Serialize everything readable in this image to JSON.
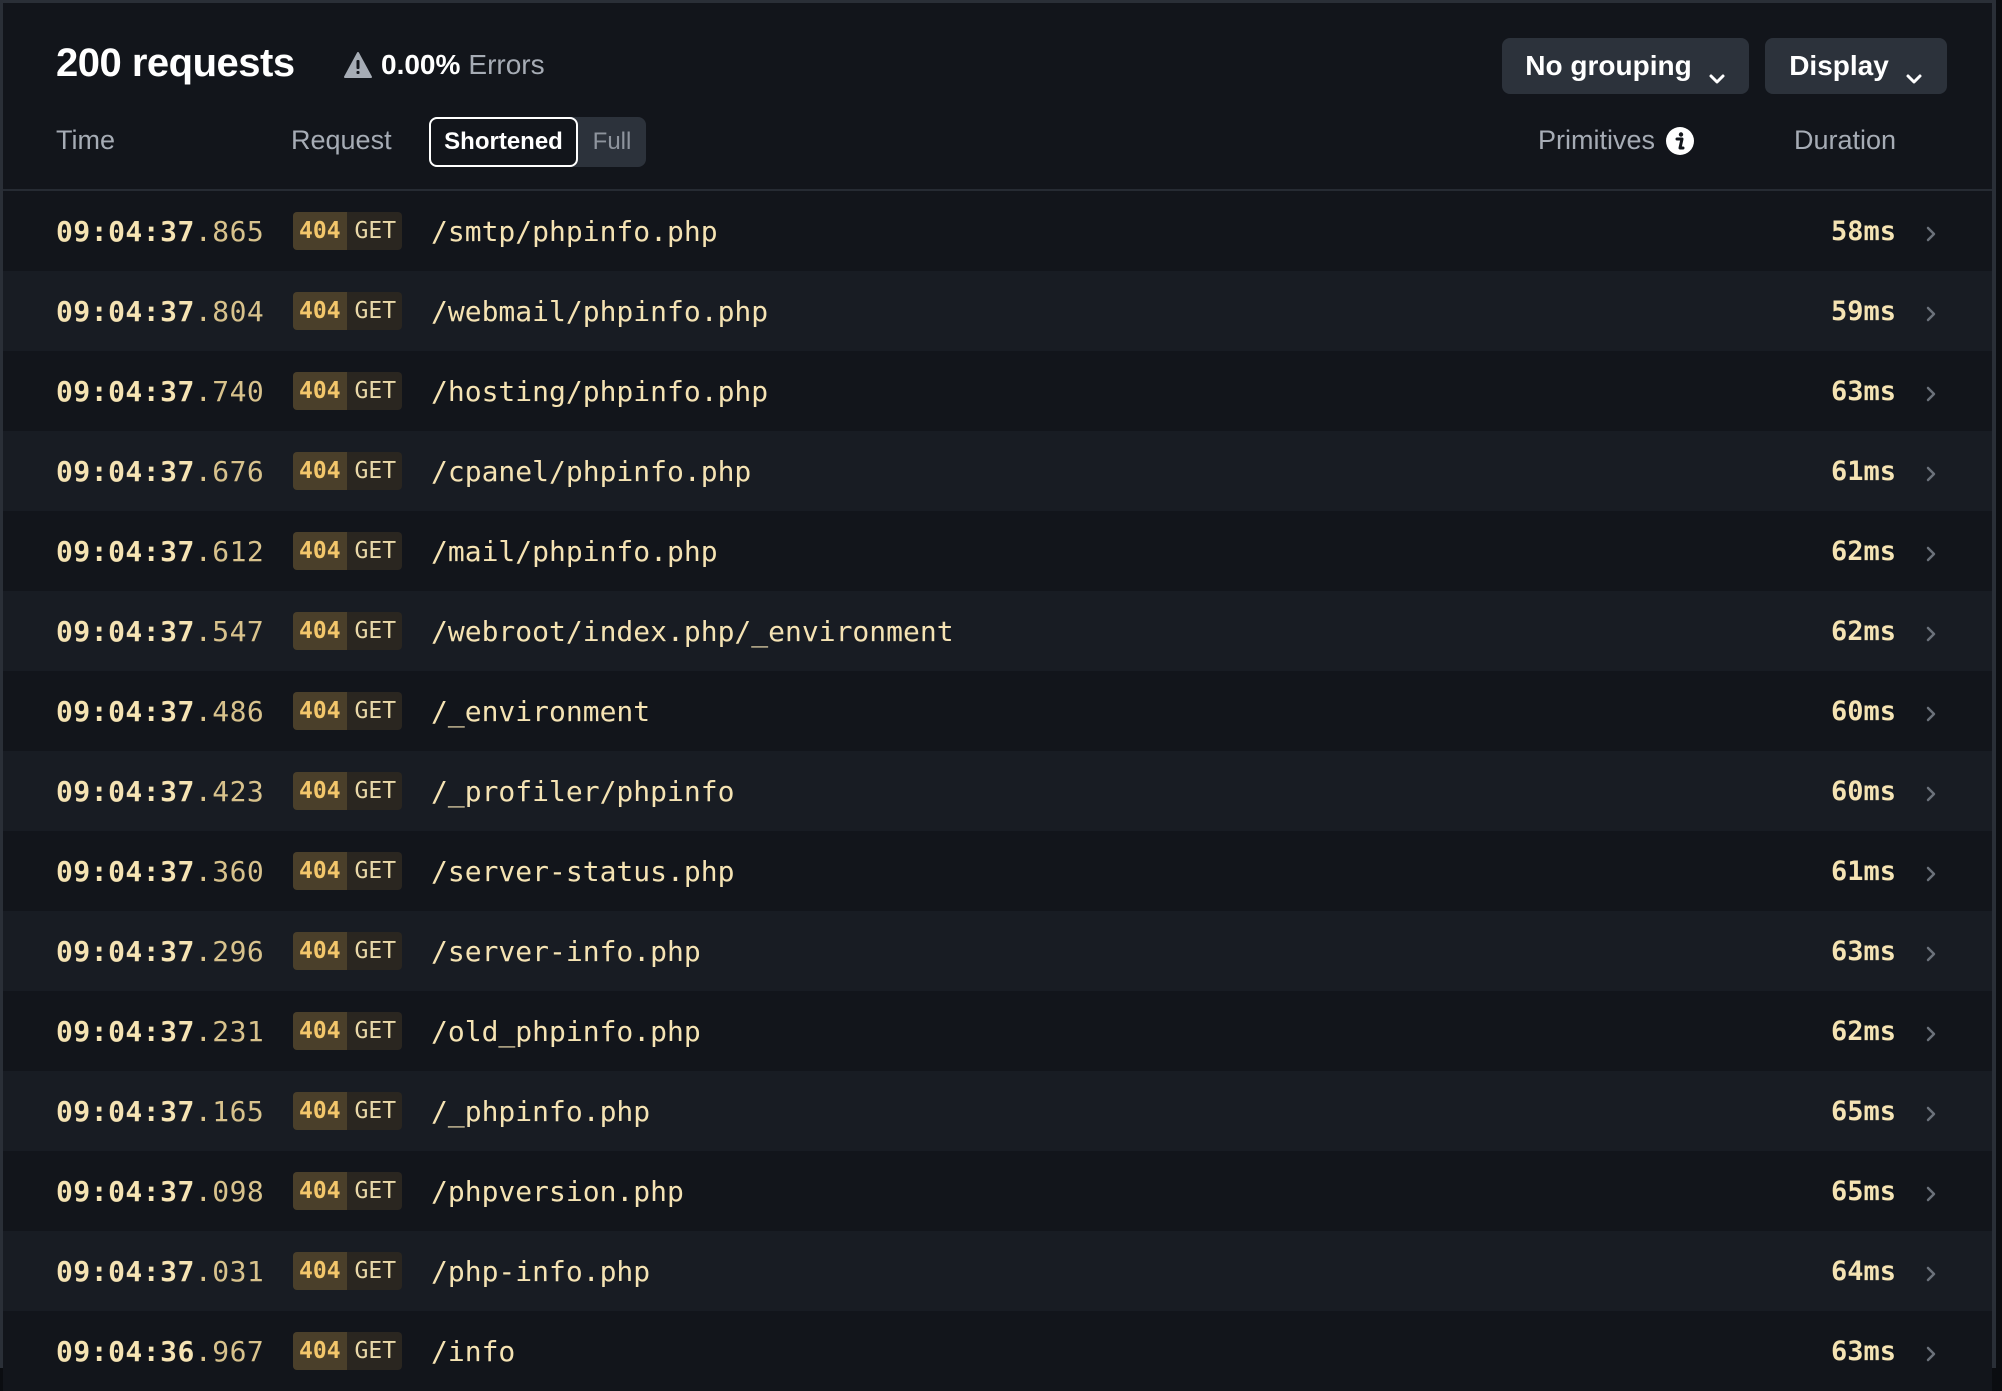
{
  "header": {
    "title": "200 requests",
    "errors_pct": "0.00%",
    "errors_label": "Errors",
    "grouping_label": "No grouping",
    "display_label": "Display"
  },
  "columns": {
    "time": "Time",
    "request": "Request",
    "primitives": "Primitives",
    "duration": "Duration"
  },
  "request_mode": {
    "shortened": "Shortened",
    "full": "Full",
    "selected": "Shortened"
  },
  "rows": [
    {
      "time_main": "09:04:37",
      "time_ms": ".865",
      "status": "404",
      "method": "GET",
      "path": "/smtp/phpinfo.php",
      "duration": "58ms"
    },
    {
      "time_main": "09:04:37",
      "time_ms": ".804",
      "status": "404",
      "method": "GET",
      "path": "/webmail/phpinfo.php",
      "duration": "59ms"
    },
    {
      "time_main": "09:04:37",
      "time_ms": ".740",
      "status": "404",
      "method": "GET",
      "path": "/hosting/phpinfo.php",
      "duration": "63ms"
    },
    {
      "time_main": "09:04:37",
      "time_ms": ".676",
      "status": "404",
      "method": "GET",
      "path": "/cpanel/phpinfo.php",
      "duration": "61ms"
    },
    {
      "time_main": "09:04:37",
      "time_ms": ".612",
      "status": "404",
      "method": "GET",
      "path": "/mail/phpinfo.php",
      "duration": "62ms"
    },
    {
      "time_main": "09:04:37",
      "time_ms": ".547",
      "status": "404",
      "method": "GET",
      "path": "/webroot/index.php/_environment",
      "duration": "62ms"
    },
    {
      "time_main": "09:04:37",
      "time_ms": ".486",
      "status": "404",
      "method": "GET",
      "path": "/_environment",
      "duration": "60ms"
    },
    {
      "time_main": "09:04:37",
      "time_ms": ".423",
      "status": "404",
      "method": "GET",
      "path": "/_profiler/phpinfo",
      "duration": "60ms"
    },
    {
      "time_main": "09:04:37",
      "time_ms": ".360",
      "status": "404",
      "method": "GET",
      "path": "/server-status.php",
      "duration": "61ms"
    },
    {
      "time_main": "09:04:37",
      "time_ms": ".296",
      "status": "404",
      "method": "GET",
      "path": "/server-info.php",
      "duration": "63ms"
    },
    {
      "time_main": "09:04:37",
      "time_ms": ".231",
      "status": "404",
      "method": "GET",
      "path": "/old_phpinfo.php",
      "duration": "62ms"
    },
    {
      "time_main": "09:04:37",
      "time_ms": ".165",
      "status": "404",
      "method": "GET",
      "path": "/_phpinfo.php",
      "duration": "65ms"
    },
    {
      "time_main": "09:04:37",
      "time_ms": ".098",
      "status": "404",
      "method": "GET",
      "path": "/phpversion.php",
      "duration": "65ms"
    },
    {
      "time_main": "09:04:37",
      "time_ms": ".031",
      "status": "404",
      "method": "GET",
      "path": "/php-info.php",
      "duration": "64ms"
    },
    {
      "time_main": "09:04:36",
      "time_ms": ".967",
      "status": "404",
      "method": "GET",
      "path": "/info",
      "duration": "63ms"
    }
  ],
  "icons": {
    "warning": "warning-triangle-icon",
    "chevron_down": "chevron-down-icon",
    "info": "info-circle-icon",
    "chevron_right": "chevron-right-icon"
  }
}
